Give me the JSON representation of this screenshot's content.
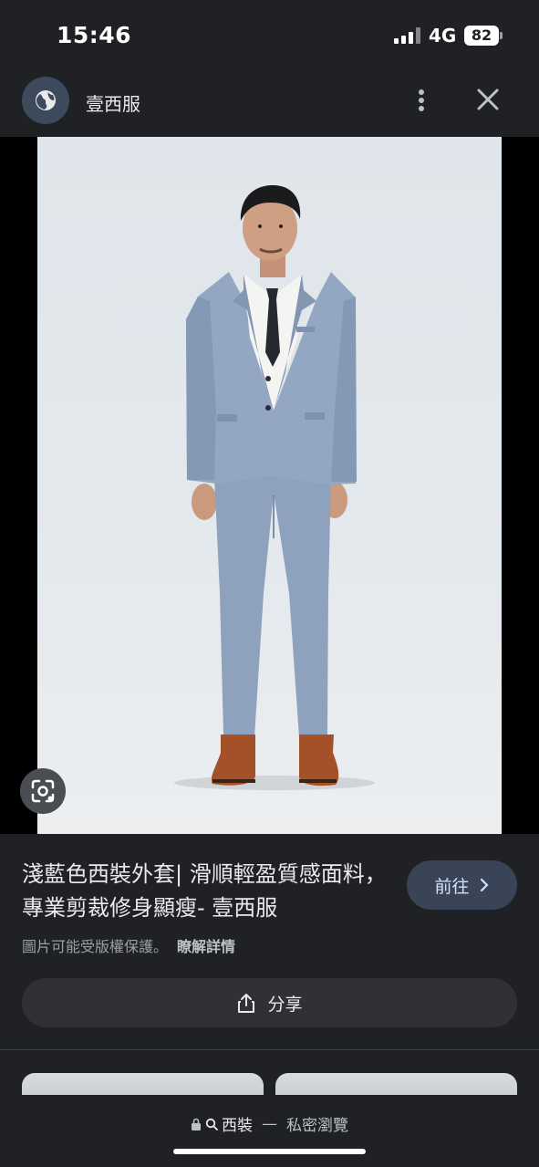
{
  "status_bar": {
    "time": "15:46",
    "network": "4G",
    "battery": "82"
  },
  "header": {
    "site_name": "壹西服",
    "site_icon": "globe-icon",
    "menu_icon": "more-vert-icon",
    "close_icon": "close-icon"
  },
  "result": {
    "title": "淺藍色西裝外套| 滑順輕盈質感面料，專業剪裁修身顯瘦- 壹西服",
    "visit_label": "前往",
    "copyright_text": "圖片可能受版權保護。",
    "learn_more": "瞭解詳情",
    "share_label": "分享"
  },
  "bottom": {
    "query": "西裝",
    "separator": "—",
    "mode": "私密瀏覽"
  },
  "colors": {
    "background": "#202124",
    "visit_button": "#394457",
    "share_button": "#303134"
  }
}
